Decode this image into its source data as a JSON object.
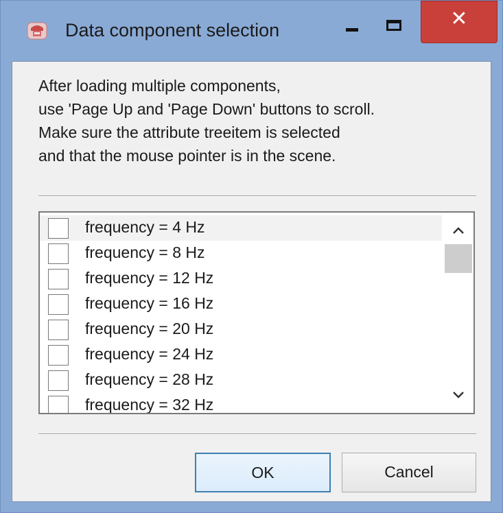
{
  "window": {
    "title": "Data component selection",
    "close_glyph": "✕",
    "icons": {
      "app": "app-icon",
      "minimize": "minimize-icon",
      "maximize": "maximize-icon",
      "close": "close-icon"
    },
    "colors": {
      "frame": "#8aaad6",
      "close_button": "#c9403a",
      "client_bg": "#f0f0f0"
    }
  },
  "info": {
    "lines": [
      "After loading multiple components,",
      "use 'Page Up and 'Page Down' buttons to scroll.",
      "Make sure the attribute treeitem is selected",
      "and that the mouse pointer is in the scene."
    ]
  },
  "list": {
    "items": [
      {
        "label": "frequency = 4 Hz",
        "checked": false
      },
      {
        "label": "frequency = 8 Hz",
        "checked": false
      },
      {
        "label": "frequency = 12 Hz",
        "checked": false
      },
      {
        "label": "frequency = 16 Hz",
        "checked": false
      },
      {
        "label": "frequency = 20 Hz",
        "checked": false
      },
      {
        "label": "frequency = 24 Hz",
        "checked": false
      },
      {
        "label": "frequency = 28 Hz",
        "checked": false
      },
      {
        "label": "frequency = 32 Hz",
        "checked": false
      }
    ],
    "scroll_up_icon": "chevron-up-icon",
    "scroll_down_icon": "chevron-down-icon"
  },
  "buttons": {
    "ok": "OK",
    "cancel": "Cancel"
  }
}
